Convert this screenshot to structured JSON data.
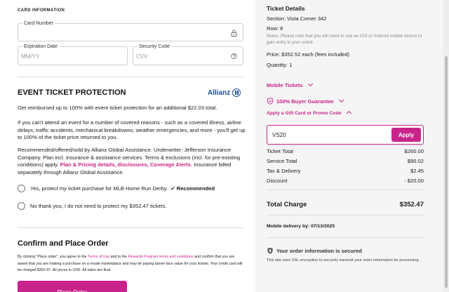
{
  "payment": {
    "section_label": "CARD INFORMATION",
    "card_number": {
      "label": "Card Number",
      "value": ""
    },
    "expiration": {
      "label": "Expiration Date",
      "placeholder": "MM/YY"
    },
    "security_code": {
      "label": "Security Code",
      "placeholder": "CVV"
    }
  },
  "protection": {
    "title": "EVENT TICKET PROTECTION",
    "brand": "Allianz",
    "lead": "Get reimbursed up to 100% with event ticket protection for an additional $22.03 total.",
    "body": "If you can't attend an event for a number of covered reasons - such as a covered illness, airline delays, traffic accidents, mechanical breakdowns, weather emergencies, and more - you'll get up to 100% of the ticket price returned to you.",
    "legal_pre": "Recommended/offered/sold by Allianz Global Assistance. Underwriter: Jefferson Insurance Company. Plan incl. insurance & assistance services. Terms & exclusions (incl. for pre-existing conditions) apply. ",
    "legal_link": "Plan & Pricing details, disclosures, Coverage Alerts",
    "legal_post": ". Insurance billed separately through Allianz Global Assistance.",
    "option_yes": "Yes, protect my ticket purchase for MLB Home Run Derby.",
    "recommended": "✔ Recommended",
    "option_no": "No thank you, I do not need to protect my $352.47 tickets."
  },
  "confirm": {
    "title": "Confirm and Place Order",
    "fine_1": "By clicking \"Place order\", you agree to the ",
    "terms_link": "Terms of Use",
    "fine_2": " and to the ",
    "rewards_link": "Rewards Program terms and conditions",
    "fine_3": " and confirm that you are aware that you are making a purchase on a resale marketplace and may be paying above face value for your tickets. Your credit card will be charged $352.47. All prices in USD. All sales are final.",
    "button": "Place Order"
  },
  "ticket": {
    "title": "Ticket Details",
    "section": "Section: Vista Corner 342",
    "row": "Row: 8",
    "notes": "Notes: Please note that you will need to use an iOS or Android mobile device to gain entry to your event.",
    "price": "Price: $352.52 each",
    "price_note": " (fees included)",
    "quantity": "Quantity: 1",
    "mobile_tickets": "Mobile Tickets",
    "guarantee": "100% Buyer Guarantee",
    "promo_toggle": "Apply a Gift Card or Promo Code",
    "promo_value": "VS20",
    "apply": "Apply"
  },
  "summary": {
    "rows": [
      {
        "label": "Ticket Total",
        "value": "$260.00"
      },
      {
        "label": "Service Total",
        "value": "$90.02"
      },
      {
        "label": "Tax & Delivery",
        "value": "$2.45"
      },
      {
        "label": "Discount",
        "value": "- $20.00"
      }
    ],
    "total_label": "Total Charge",
    "total_value": "$352.47",
    "delivery": "Mobile delivery by: 07/13/2025",
    "secure_title": "Your order information is secured",
    "secure_text": "This site uses SSL encryption to securely transmit your order information for processing."
  },
  "colors": {
    "accent": "#c8238a",
    "brand_allianz": "#1f4e9c",
    "panel": "#f5f5f5"
  },
  "icons": [
    "lock-icon",
    "help-circle-icon",
    "allianz-logo-icon",
    "chevron-down-icon",
    "chevron-up-icon",
    "shield-check-icon",
    "lock-shield-icon"
  ]
}
